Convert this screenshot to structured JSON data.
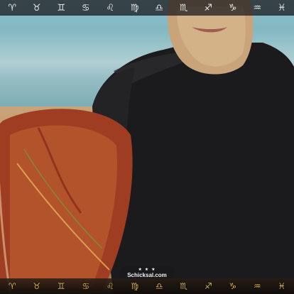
{
  "topbar": {
    "signs": [
      {
        "glyph": "♈",
        "icon": "aries-icon"
      },
      {
        "glyph": "♉",
        "icon": "taurus-icon"
      },
      {
        "glyph": "♊",
        "icon": "gemini-icon"
      },
      {
        "glyph": "♋",
        "icon": "cancer-icon"
      },
      {
        "glyph": "♌",
        "icon": "leo-icon"
      },
      {
        "glyph": "♍",
        "icon": "virgo-icon"
      },
      {
        "glyph": "♎",
        "icon": "libra-icon"
      },
      {
        "glyph": "♏",
        "icon": "scorpio-icon"
      },
      {
        "glyph": "♐",
        "icon": "sagittarius-icon"
      },
      {
        "glyph": "♑",
        "icon": "capricorn-icon"
      },
      {
        "glyph": "♒",
        "icon": "aquarius-icon"
      },
      {
        "glyph": "♓",
        "icon": "pisces-icon"
      }
    ],
    "color": "#e9e9e9"
  },
  "logo": {
    "stars": "★ ★ ★",
    "brand": "Schicksal.com"
  },
  "bottombar": {
    "signs": [
      {
        "glyph": "♈",
        "icon": "aries-emblem-icon"
      },
      {
        "glyph": "♉",
        "icon": "taurus-emblem-icon"
      },
      {
        "glyph": "♊",
        "icon": "gemini-emblem-icon"
      },
      {
        "glyph": "♋",
        "icon": "cancer-emblem-icon"
      },
      {
        "glyph": "♌",
        "icon": "leo-emblem-icon"
      },
      {
        "glyph": "♍",
        "icon": "virgo-emblem-icon"
      },
      {
        "glyph": "♎",
        "icon": "libra-emblem-icon"
      },
      {
        "glyph": "♏",
        "icon": "scorpio-emblem-icon"
      },
      {
        "glyph": "♐",
        "icon": "sagittarius-emblem-icon"
      },
      {
        "glyph": "♑",
        "icon": "capricorn-emblem-icon"
      },
      {
        "glyph": "♒",
        "icon": "aquarius-emblem-icon"
      },
      {
        "glyph": "♓",
        "icon": "pisces-emblem-icon"
      }
    ],
    "color": "#d8b44a"
  }
}
